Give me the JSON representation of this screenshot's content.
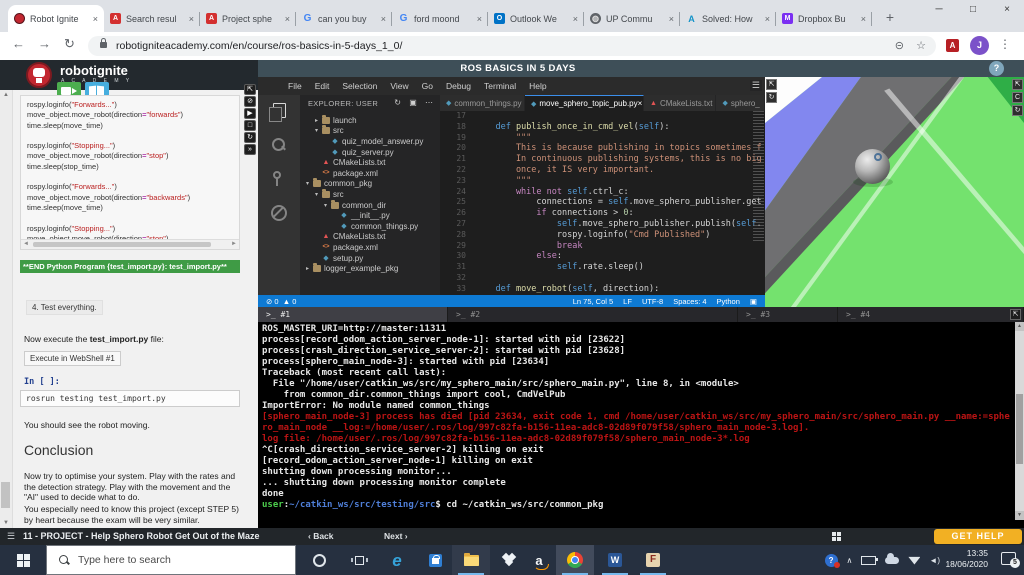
{
  "colors": {
    "status_blue": "#0e7ad3",
    "get_help_yellow": "#f2b023",
    "banner_green": "#3f9b45",
    "terminal_red": "#bb1414",
    "sim_green": "#74e26e",
    "sim_blue": "#8287ef",
    "active_tab_accent": "#3b8eea",
    "taskbar_bg": "#263040"
  },
  "browser": {
    "tabs": [
      {
        "label": "Robot Ignite",
        "icon": "robotignite-favicon",
        "active": true
      },
      {
        "label": "Search resul",
        "icon": "pdf-icon",
        "active": false
      },
      {
        "label": "Project sphe",
        "icon": "pdf-icon",
        "active": false
      },
      {
        "label": "can you buy",
        "icon": "google-icon",
        "active": false
      },
      {
        "label": "ford moond",
        "icon": "google-icon",
        "active": false
      },
      {
        "label": "Outlook We",
        "icon": "outlook-icon",
        "active": false
      },
      {
        "label": "UP Commu",
        "icon": "globe-icon",
        "active": false
      },
      {
        "label": "Solved: How",
        "icon": "autodesk-icon",
        "active": false
      },
      {
        "label": "Dropbox Bu",
        "icon": "dropbox-m-icon",
        "active": false
      }
    ],
    "new_tab_label": "+",
    "url": "robotigniteacademy.com/en/course/ros-basics-in-5-days_1_0/",
    "avatar_letter": "J"
  },
  "site": {
    "logo_title": "robotignite",
    "logo_subtitle": "A C A D E M Y",
    "header_title": "ROS BASICS IN 5 DAYS",
    "help_label": "?"
  },
  "notebook": {
    "code_lines": [
      [
        [
          "t",
          "rospy.loginfo("
        ],
        [
          "s",
          "\"Forwards...\""
        ],
        [
          "t",
          ")"
        ]
      ],
      [
        [
          "t",
          "move_object.move_robot(direction"
        ],
        [
          "o",
          "="
        ],
        [
          "s",
          "\"forwards\""
        ],
        [
          "t",
          ")"
        ]
      ],
      [
        [
          "t",
          "time.sleep(move_time)"
        ]
      ],
      [],
      [
        [
          "t",
          "rospy.loginfo("
        ],
        [
          "s",
          "\"Stopping...\""
        ],
        [
          "t",
          ")"
        ]
      ],
      [
        [
          "t",
          "move_object.move_robot(direction"
        ],
        [
          "o",
          "="
        ],
        [
          "s",
          "\"stop\""
        ],
        [
          "t",
          ")"
        ]
      ],
      [
        [
          "t",
          "time.sleep(stop_time)"
        ]
      ],
      [],
      [
        [
          "t",
          "rospy.loginfo("
        ],
        [
          "s",
          "\"Forwards...\""
        ],
        [
          "t",
          ")"
        ]
      ],
      [
        [
          "t",
          "move_object.move_robot(direction"
        ],
        [
          "o",
          "="
        ],
        [
          "s",
          "\"backwards\""
        ],
        [
          "t",
          ")"
        ]
      ],
      [
        [
          "t",
          "time.sleep(move_time)"
        ]
      ],
      [],
      [
        [
          "t",
          "rospy.loginfo("
        ],
        [
          "s",
          "\"Stopping...\""
        ],
        [
          "t",
          ")"
        ]
      ],
      [
        [
          "t",
          "move_object.move_robot(direction"
        ],
        [
          "o",
          "="
        ],
        [
          "s",
          "\"stop\""
        ],
        [
          "t",
          ")"
        ]
      ]
    ],
    "end_banner": "**END Python Program {test_import.py}: test_import.py**",
    "step": "4. Test everything.",
    "exec_pre": "Now execute the ",
    "exec_bold": "test_import.py",
    "exec_post": " file:",
    "webshell_note": "Execute in WebShell #1",
    "in_label": "In [ ]:",
    "command": "rosrun testing test_import.py",
    "result_note": "You should see the robot moving.",
    "conclusion_title": "Conclusion",
    "conclusion_p1": "Now try to optimise your system. Play with the rates and the detection strategy. Play with the movement and the \"AI\" used to decide what to do.",
    "conclusion_p2": "You especially need to know this project (except STEP 5) by heart because the exam will be very similar."
  },
  "unitbar": {
    "title": "11 - PROJECT - Help Sphero Robot Get Out of the Maze",
    "back": "‹ Back",
    "next": "Next ›",
    "get_help": "GET HELP"
  },
  "ide": {
    "menu": [
      "File",
      "Edit",
      "Selection",
      "View",
      "Go",
      "Debug",
      "Terminal",
      "Help"
    ],
    "activity_icons": [
      "files-icon",
      "search-icon",
      "source-control-icon",
      "debug-disabled-icon"
    ],
    "explorer_title": "EXPLORER: USER",
    "explorer_action_icons": [
      "refresh-icon",
      "collapse-icon",
      "more-icon"
    ],
    "tree": [
      {
        "arrow": "▸",
        "icon": "folder",
        "label": "launch",
        "indent": 1
      },
      {
        "arrow": "▾",
        "icon": "folder",
        "label": "src",
        "indent": 1
      },
      {
        "arrow": "",
        "icon": "py",
        "label": "quiz_model_answer.py",
        "indent": 2
      },
      {
        "arrow": "",
        "icon": "py",
        "label": "quiz_server.py",
        "indent": 2
      },
      {
        "arrow": "",
        "icon": "warn",
        "label": "CMakeLists.txt",
        "indent": 1
      },
      {
        "arrow": "",
        "icon": "xml",
        "label": "package.xml",
        "indent": 1
      },
      {
        "arrow": "▾",
        "icon": "folder",
        "label": "common_pkg",
        "indent": 0
      },
      {
        "arrow": "▾",
        "icon": "folder",
        "label": "src",
        "indent": 1
      },
      {
        "arrow": "▾",
        "icon": "folder",
        "label": "common_dir",
        "indent": 2
      },
      {
        "arrow": "",
        "icon": "py",
        "label": "__init__.py",
        "indent": 3
      },
      {
        "arrow": "",
        "icon": "py",
        "label": "common_things.py",
        "indent": 3
      },
      {
        "arrow": "",
        "icon": "warn",
        "label": "CMakeLists.txt",
        "indent": 1
      },
      {
        "arrow": "",
        "icon": "xml",
        "label": "package.xml",
        "indent": 1
      },
      {
        "arrow": "",
        "icon": "py",
        "label": "setup.py",
        "indent": 1
      },
      {
        "arrow": "▸",
        "icon": "folder",
        "label": "logger_example_pkg",
        "indent": 0
      }
    ],
    "editor_tabs": [
      {
        "label": "common_things.py",
        "icon": "py",
        "active": false,
        "close": ""
      },
      {
        "label": "move_sphero_topic_pub.py",
        "icon": "py",
        "active": true,
        "close": "×"
      },
      {
        "label": "CMakeLists.txt",
        "icon": "warn",
        "active": false,
        "close": ""
      },
      {
        "label": "sphero_",
        "icon": "py",
        "active": false,
        "close": ""
      }
    ],
    "code_lines": [
      {
        "n": "17",
        "segs": []
      },
      {
        "n": "18",
        "segs": [
          [
            "d",
            "    def "
          ],
          [
            "f",
            "publish_once_in_cmd_vel"
          ],
          [
            "t",
            "("
          ],
          [
            "d",
            "self"
          ],
          [
            "t",
            "):"
          ]
        ]
      },
      {
        "n": "19",
        "segs": [
          [
            "s",
            "        \"\"\""
          ]
        ]
      },
      {
        "n": "20",
        "segs": [
          [
            "s",
            "        This is because publishing in topics sometimes f"
          ]
        ]
      },
      {
        "n": "21",
        "segs": [
          [
            "s",
            "        In continuous publishing systems, this is no big"
          ]
        ]
      },
      {
        "n": "22",
        "segs": [
          [
            "s",
            "        once, it IS very important."
          ]
        ]
      },
      {
        "n": "23",
        "segs": [
          [
            "s",
            "        \"\"\""
          ]
        ]
      },
      {
        "n": "24",
        "segs": [
          [
            "k",
            "        while "
          ],
          [
            "k",
            "not "
          ],
          [
            "d",
            "self"
          ],
          [
            "t",
            ".ctrl_c:"
          ]
        ]
      },
      {
        "n": "25",
        "segs": [
          [
            "t",
            "            connections = "
          ],
          [
            "d",
            "self"
          ],
          [
            "t",
            ".move_sphero_publisher.get"
          ]
        ]
      },
      {
        "n": "26",
        "segs": [
          [
            "k",
            "            if "
          ],
          [
            "t",
            "connections > "
          ],
          [
            "n2",
            "0"
          ],
          [
            "t",
            ":"
          ]
        ]
      },
      {
        "n": "27",
        "segs": [
          [
            "t",
            "                "
          ],
          [
            "d",
            "self"
          ],
          [
            "t",
            ".move_sphero_publisher.publish("
          ],
          [
            "d",
            "self"
          ],
          [
            "t",
            "."
          ]
        ]
      },
      {
        "n": "28",
        "segs": [
          [
            "t",
            "                rospy.loginfo("
          ],
          [
            "s",
            "\"Cmd Published\""
          ],
          [
            "t",
            ")"
          ]
        ]
      },
      {
        "n": "29",
        "segs": [
          [
            "k",
            "                break"
          ]
        ]
      },
      {
        "n": "30",
        "segs": [
          [
            "k",
            "            else"
          ],
          [
            "t",
            ":"
          ]
        ]
      },
      {
        "n": "31",
        "segs": [
          [
            "t",
            "                "
          ],
          [
            "d",
            "self"
          ],
          [
            "t",
            ".rate.sleep()"
          ]
        ]
      },
      {
        "n": "32",
        "segs": []
      },
      {
        "n": "33",
        "segs": [
          [
            "d",
            "    def "
          ],
          [
            "f",
            "move_robot"
          ],
          [
            "t",
            "("
          ],
          [
            "d",
            "self"
          ],
          [
            "t",
            ", direction):"
          ]
        ]
      }
    ],
    "status": {
      "errors": "0",
      "warnings": "0",
      "items": [
        "Ln 75, Col 5",
        "LF",
        "UTF-8",
        "Spaces: 4",
        "Python"
      ]
    },
    "terminal_tabs": [
      {
        "label": ">_ #1",
        "active": true
      },
      {
        "label": ">_ #2",
        "active": false
      },
      {
        "label": ">_ #3",
        "active": false
      },
      {
        "label": ">_ #4",
        "active": false
      }
    ]
  },
  "terminal": {
    "lines": [
      [
        [
          "w",
          "ROS_MASTER_URI=http://master:11311"
        ]
      ],
      [
        [
          "w",
          ""
        ]
      ],
      [
        [
          "w",
          "process[record_odom_action_server_node-1]: started with pid [23622]"
        ]
      ],
      [
        [
          "w",
          "process[crash_direction_service_server-2]: started with pid [23628]"
        ]
      ],
      [
        [
          "w",
          "process[sphero_main_node-3]: started with pid [23634]"
        ]
      ],
      [
        [
          "w",
          "Traceback (most recent call last):"
        ]
      ],
      [
        [
          "w",
          "  File \"/home/user/catkin_ws/src/my_sphero_main/src/sphero_main.py\", line 8, in <module>"
        ]
      ],
      [
        [
          "w",
          "    from common_dir.common_things import cool, CmdVelPub"
        ]
      ],
      [
        [
          "w",
          "ImportError: No module named common_things"
        ]
      ],
      [
        [
          "r",
          "[sphero_main_node-3] process has died [pid 23634, exit code 1, cmd /home/user/catkin_ws/src/my_sphero_main/src/sphero_main.py __name:=sphe"
        ]
      ],
      [
        [
          "r",
          "ro_main_node __log:=/home/user/.ros/log/997c82fa-b156-11ea-adc8-02d89f079f58/sphero_main_node-3.log]."
        ]
      ],
      [
        [
          "r",
          "log file: /home/user/.ros/log/997c82fa-b156-11ea-adc8-02d89f079f58/sphero_main_node-3*.log"
        ]
      ],
      [
        [
          "w",
          "^C[crash_direction_service_server-2] killing on exit"
        ]
      ],
      [
        [
          "w",
          "[record_odom_action_server_node-1] killing on exit"
        ]
      ],
      [
        [
          "w",
          "shutting down processing monitor..."
        ]
      ],
      [
        [
          "w",
          "... shutting down processing monitor complete"
        ]
      ],
      [
        [
          "w",
          "done"
        ]
      ],
      [
        [
          "g",
          "user"
        ],
        [
          "w",
          ":"
        ],
        [
          "b",
          "~/catkin_ws/src/testing/src"
        ],
        [
          "w",
          "$ cd ~/catkin_ws/src/common_pkg"
        ]
      ]
    ]
  },
  "sim": {
    "robot": "sphero-sphere-robot",
    "left_buttons": [
      "expand-icon",
      "refresh-icon"
    ],
    "right_buttons": [
      "expand-icon",
      "rotate-icon",
      "refresh-icon"
    ]
  },
  "taskbar": {
    "search_placeholder": "Type here to search",
    "icons": [
      "start-icon",
      "cortana-icon",
      "task-view-icon",
      "edge-icon",
      "store-icon",
      "file-explorer-icon",
      "dropbox-icon",
      "amazon-icon",
      "chrome-icon",
      "word-icon",
      "filezilla-icon",
      "help-tray-icon",
      "chevron-up-icon",
      "battery-icon",
      "onedrive-icon",
      "wifi-icon",
      "volume-icon",
      "notifications-icon"
    ],
    "time": "13:35",
    "date": "18/06/2020",
    "badge": "5"
  }
}
